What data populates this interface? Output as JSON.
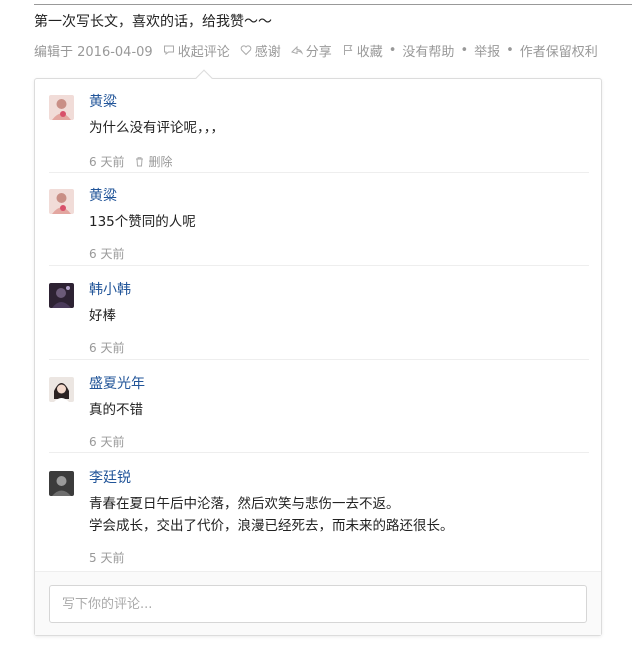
{
  "answer": {
    "text": "第一次写长文，喜欢的话，给我赞～～"
  },
  "meta": {
    "edited": "编辑于 2016-04-09",
    "collapse_comments": "收起评论",
    "thanks": "感谢",
    "share": "分享",
    "collect": "收藏",
    "not_helpful": "没有帮助",
    "report": "举报",
    "rights": "作者保留权利"
  },
  "comments": [
    {
      "author": "黄粱",
      "lines": [
        "为什么没有评论呢，，，"
      ],
      "time": "6 天前",
      "delete_label": "删除",
      "avatar_color": "#e8c7c3"
    },
    {
      "author": "黄粱",
      "lines": [
        "135个赞同的人呢"
      ],
      "time": "6 天前",
      "avatar_color": "#e8c7c3"
    },
    {
      "author": "韩小韩",
      "lines": [
        "好棒"
      ],
      "time": "6 天前",
      "avatar_color": "#3a2a3a"
    },
    {
      "author": "盛夏光年",
      "lines": [
        "真的不错"
      ],
      "time": "6 天前",
      "avatar_color": "#d9cfc9"
    },
    {
      "author": "李廷锐",
      "lines": [
        "青春在夏日午后中沦落，然后欢笑与悲伤一去不返。",
        "学会成长，交出了代价，浪漫已经死去，而未来的路还很长。"
      ],
      "time": "5 天前",
      "avatar_color": "#4a4a4a"
    }
  ],
  "composer": {
    "placeholder": "写下你的评论..."
  },
  "colors": {
    "link": "#225599",
    "meta": "#999999"
  }
}
